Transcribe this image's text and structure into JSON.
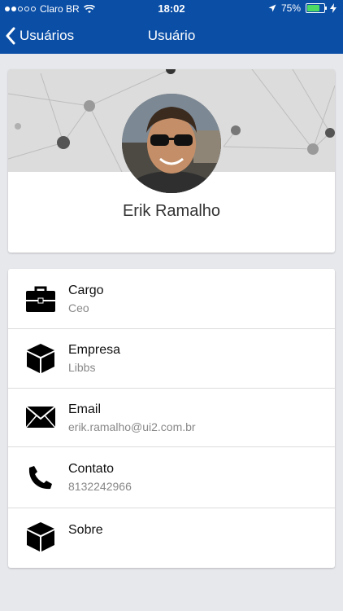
{
  "status_bar": {
    "carrier": "Claro BR",
    "time": "18:02",
    "battery": "75%",
    "battery_level": 0.75
  },
  "nav": {
    "back_label": "Usuários",
    "title": "Usuário"
  },
  "profile": {
    "name": "Erik Ramalho"
  },
  "info": [
    {
      "label": "Cargo",
      "value": "Ceo",
      "icon": "briefcase-icon"
    },
    {
      "label": "Empresa",
      "value": "Libbs",
      "icon": "box-icon"
    },
    {
      "label": "Email",
      "value": "erik.ramalho@ui2.com.br",
      "icon": "envelope-icon"
    },
    {
      "label": "Contato",
      "value": "8132242966",
      "icon": "phone-icon"
    },
    {
      "label": "Sobre",
      "value": "",
      "icon": "box-icon"
    }
  ]
}
